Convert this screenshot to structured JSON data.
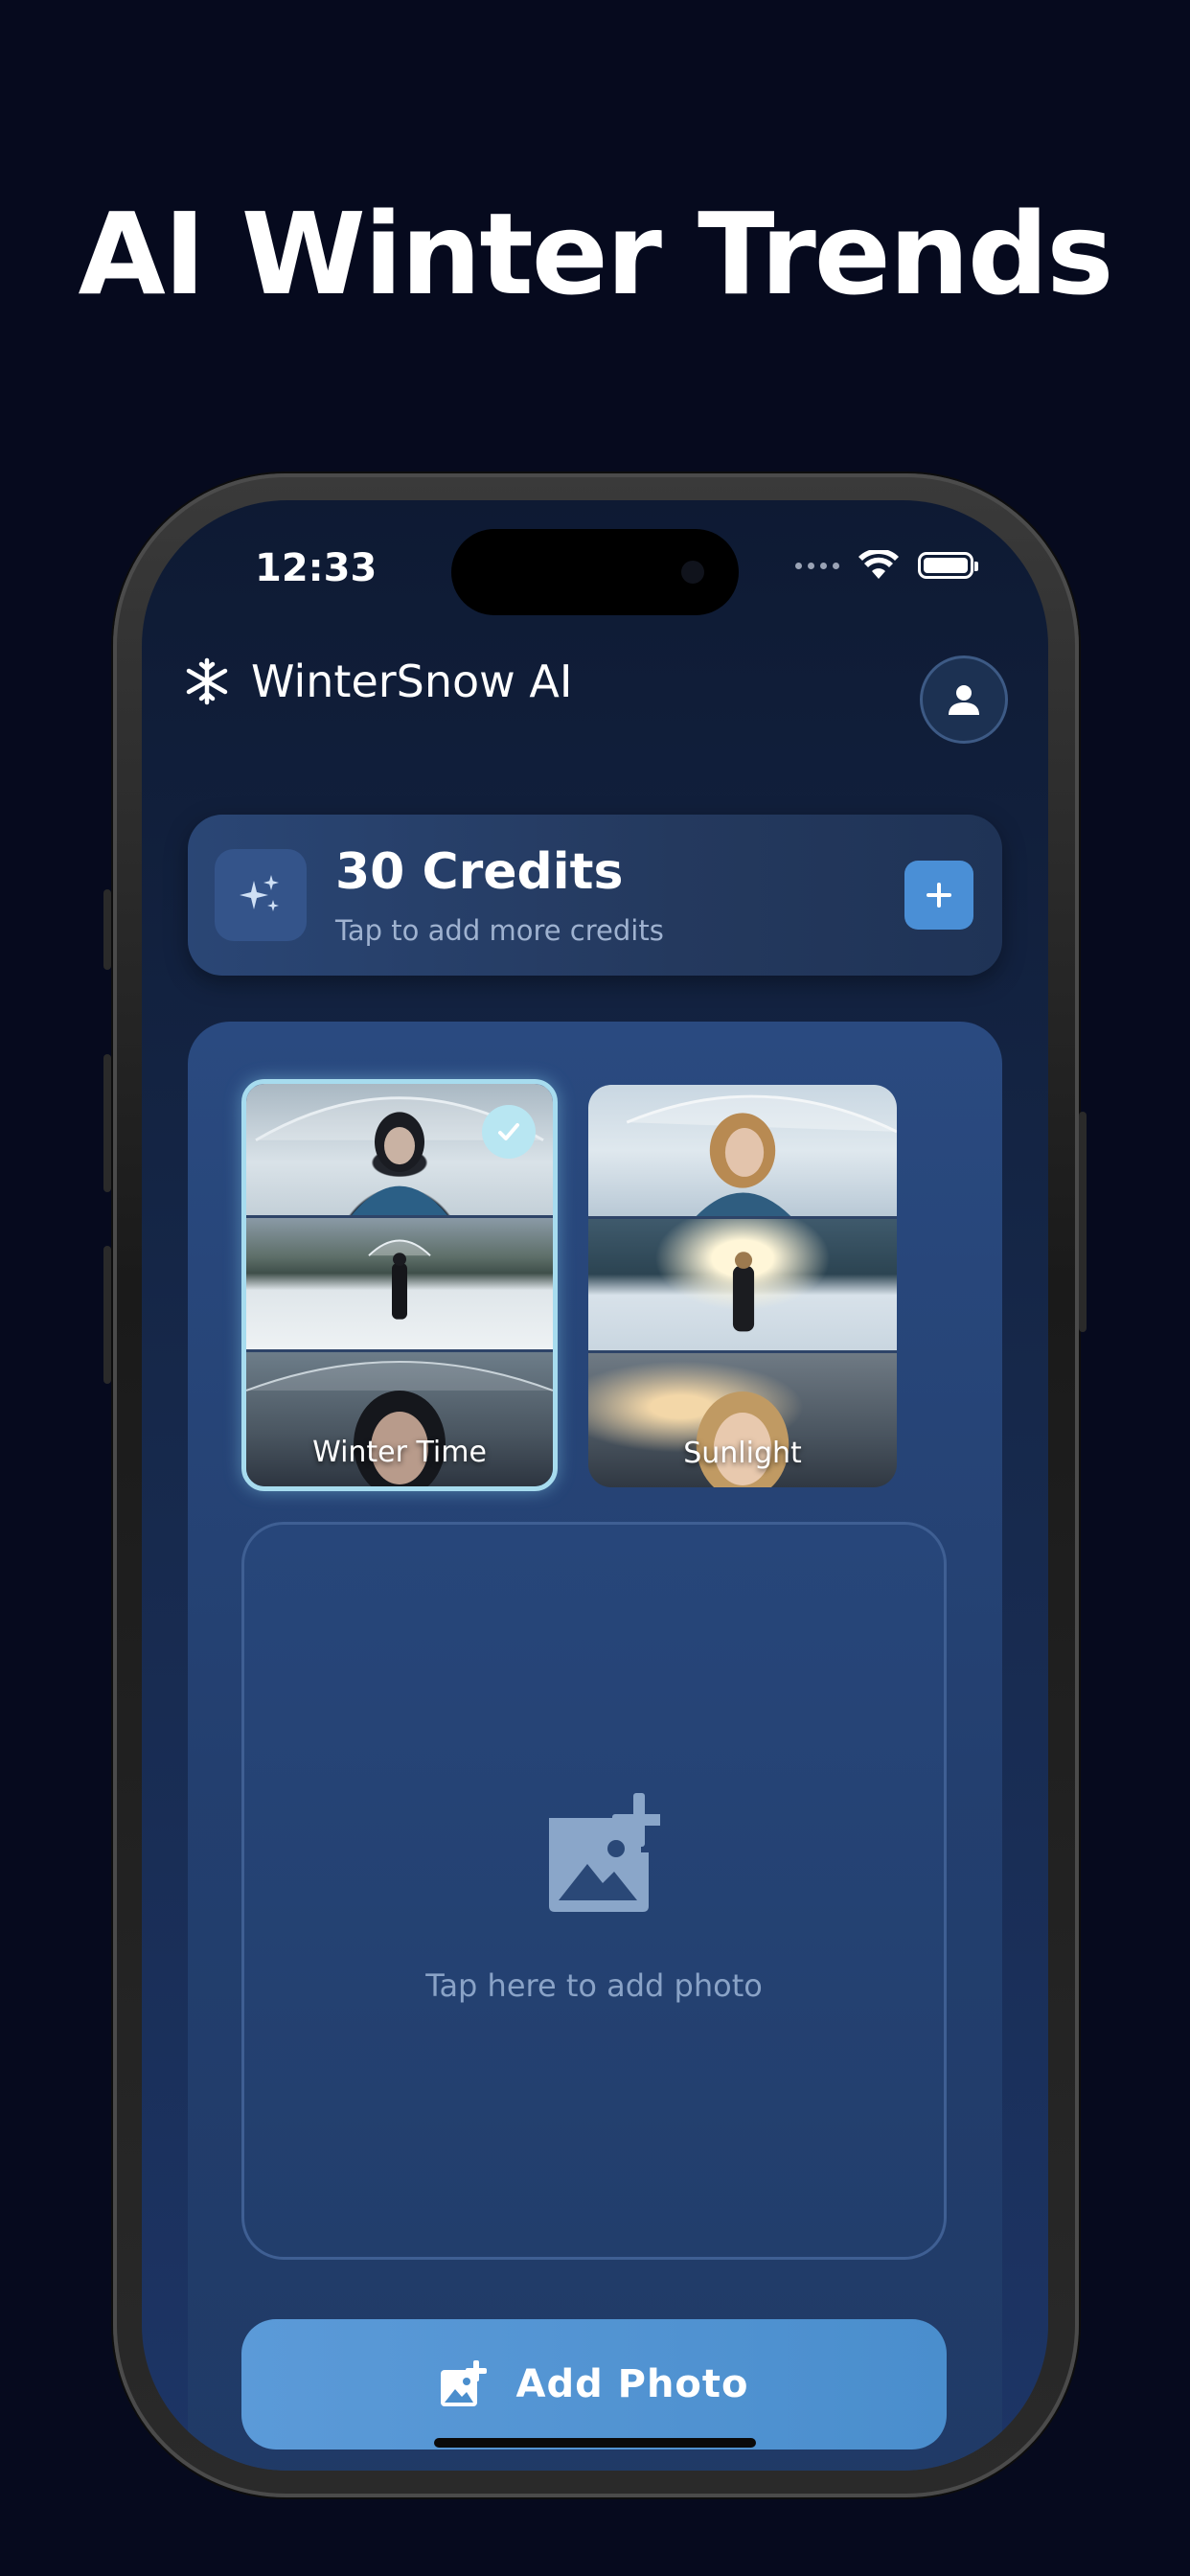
{
  "headline": "AI Winter Trends",
  "status_bar": {
    "time": "12:33"
  },
  "app": {
    "name": "WinterSnow AI",
    "logo_icon": "snowflake-icon",
    "profile_icon": "person-icon"
  },
  "credits": {
    "title": "30 Credits",
    "subtitle": "Tap to add more credits",
    "add_icon": "plus-icon",
    "spark_icon": "sparkles-icon"
  },
  "styles": [
    {
      "label": "Winter Time",
      "selected": true
    },
    {
      "label": "Sunlight",
      "selected": false
    }
  ],
  "upload": {
    "prompt": "Tap here to add photo",
    "icon": "add-photo-icon"
  },
  "action_button": {
    "label": "Add Photo",
    "icon": "add-photo-icon"
  },
  "colors": {
    "background": "#060a1e",
    "accent": "#4a8fd6",
    "selected_border": "#a7dcef",
    "panel": "#233f6f"
  }
}
